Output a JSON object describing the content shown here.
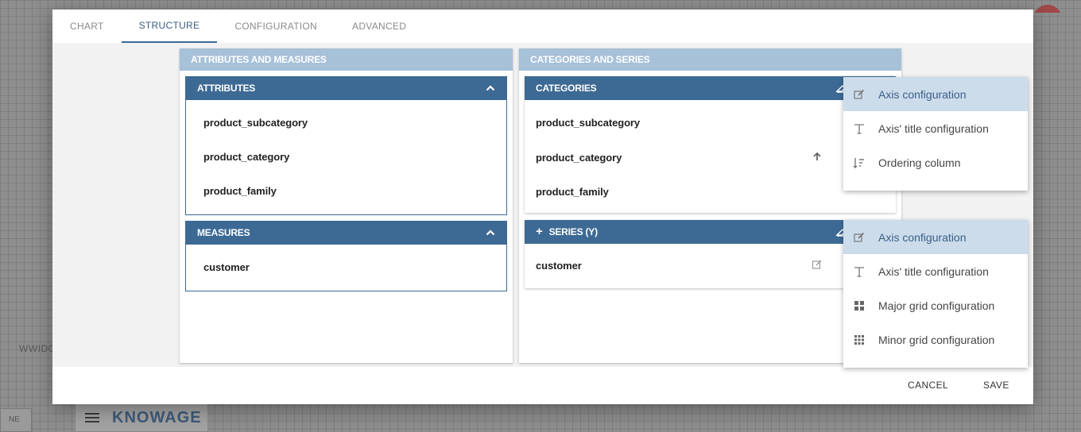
{
  "background": {
    "widget_label": "WWIDG",
    "corner_label": "NE",
    "logo_text": "KNOWAGE"
  },
  "tabs": [
    {
      "label": "CHART"
    },
    {
      "label": "STRUCTURE",
      "active": true
    },
    {
      "label": "CONFIGURATION"
    },
    {
      "label": "ADVANCED"
    }
  ],
  "left_column": {
    "title": "ATTRIBUTES AND MEASURES",
    "attributes": {
      "title": "ATTRIBUTES",
      "items": [
        "product_subcategory",
        "product_category",
        "product_family"
      ]
    },
    "measures": {
      "title": "MEASURES",
      "items": [
        "customer"
      ]
    }
  },
  "right_column": {
    "title": "CATEGORIES AND SERIES",
    "categories": {
      "title": "CATEGORIES",
      "items": [
        "product_subcategory",
        "product_category",
        "product_family"
      ]
    },
    "series": {
      "title": "SERIES (Y)",
      "add_symbol": "+",
      "items": [
        "customer"
      ]
    }
  },
  "categories_menu": [
    {
      "label": "Axis configuration",
      "icon": "edit-icon",
      "selected": true
    },
    {
      "label": "Axis' title configuration",
      "icon": "text-icon"
    },
    {
      "label": "Ordering column",
      "icon": "sort-icon"
    }
  ],
  "series_menu": [
    {
      "label": "Axis configuration",
      "icon": "edit-icon",
      "selected": true
    },
    {
      "label": "Axis' title configuration",
      "icon": "text-icon"
    },
    {
      "label": "Major grid configuration",
      "icon": "grid-large-icon"
    },
    {
      "label": "Minor grid configuration",
      "icon": "grid-small-icon"
    }
  ],
  "footer": {
    "cancel_label": "CANCEL",
    "save_label": "SAVE"
  },
  "colors": {
    "header_dark": "#3d6a94",
    "header_light": "#a7c1d9",
    "active_tab": "#3b5c80",
    "menu_selected": "#ccdceb"
  }
}
